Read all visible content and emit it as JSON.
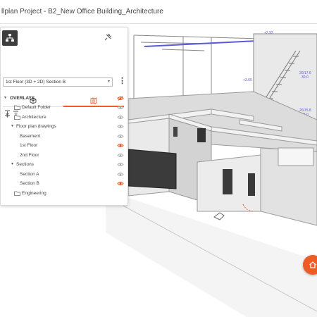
{
  "window": {
    "title": "llplan Project - B2_New Office Building_Architecture"
  },
  "panel": {
    "view_selector": {
      "selected": "1st Floor (3D + 2D) Section B"
    },
    "tabs": [
      {
        "icon": "cube-icon",
        "active": false
      },
      {
        "icon": "plan-map-icon",
        "active": true
      }
    ],
    "tree": {
      "overlays_label": "OVERLAYS",
      "default_folder": "Default Folder",
      "architecture": "Architecture",
      "floor_plan_drawings": "Floor plan drawings",
      "basement": "Basement",
      "first_floor": "1st Floor",
      "second_floor": "2nd Floor",
      "sections": "Sections",
      "section_a": "Section A",
      "section_b": "Section B",
      "engineering": "Engineering"
    }
  },
  "model_labels": {
    "stair_level": "+2.92",
    "stair_a": "20/17.6",
    "stair_b": "30.0",
    "stair_c": "20/15.8",
    "stair_d": "28.0",
    "level_small": "+3.60"
  },
  "colors": {
    "accent": "#f05a23",
    "eye_active": "#f05a23",
    "eye_inactive": "#b0b0b0",
    "dimension_blue": "#5a5ad6"
  }
}
